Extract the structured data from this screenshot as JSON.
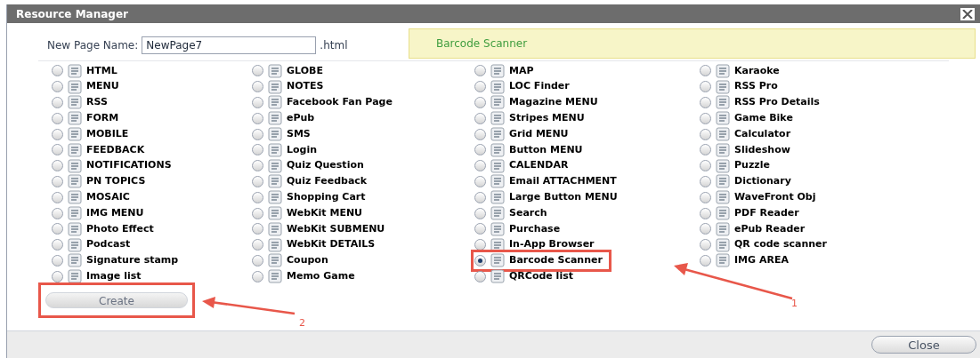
{
  "window": {
    "title": "Resource Manager"
  },
  "page_name": {
    "label": "New Page Name:",
    "value": "NewPage7",
    "suffix": ".html"
  },
  "banner": {
    "text": "Barcode Scanner"
  },
  "columns": [
    [
      {
        "label": "HTML",
        "selected": false,
        "highlighted": false
      },
      {
        "label": "MENU",
        "selected": false,
        "highlighted": false
      },
      {
        "label": "RSS",
        "selected": false,
        "highlighted": false
      },
      {
        "label": "FORM",
        "selected": false,
        "highlighted": false
      },
      {
        "label": "MOBILE",
        "selected": false,
        "highlighted": false
      },
      {
        "label": "FEEDBACK",
        "selected": false,
        "highlighted": false
      },
      {
        "label": "NOTIFICATIONS",
        "selected": false,
        "highlighted": false
      },
      {
        "label": "PN TOPICS",
        "selected": false,
        "highlighted": false
      },
      {
        "label": "MOSAIC",
        "selected": false,
        "highlighted": false
      },
      {
        "label": "IMG MENU",
        "selected": false,
        "highlighted": false
      },
      {
        "label": "Photo Effect",
        "selected": false,
        "highlighted": false
      },
      {
        "label": "Podcast",
        "selected": false,
        "highlighted": false
      },
      {
        "label": "Signature stamp",
        "selected": false,
        "highlighted": false
      },
      {
        "label": "Image list",
        "selected": false,
        "highlighted": false
      }
    ],
    [
      {
        "label": "GLOBE",
        "selected": false,
        "highlighted": false
      },
      {
        "label": "NOTES",
        "selected": false,
        "highlighted": false
      },
      {
        "label": "Facebook Fan Page",
        "selected": false,
        "highlighted": false
      },
      {
        "label": "ePub",
        "selected": false,
        "highlighted": false
      },
      {
        "label": "SMS",
        "selected": false,
        "highlighted": false
      },
      {
        "label": "Login",
        "selected": false,
        "highlighted": false
      },
      {
        "label": "Quiz Question",
        "selected": false,
        "highlighted": false
      },
      {
        "label": "Quiz Feedback",
        "selected": false,
        "highlighted": false
      },
      {
        "label": "Shopping Cart",
        "selected": false,
        "highlighted": false
      },
      {
        "label": "WebKit MENU",
        "selected": false,
        "highlighted": false
      },
      {
        "label": "WebKit SUBMENU",
        "selected": false,
        "highlighted": false
      },
      {
        "label": "WebKit DETAILS",
        "selected": false,
        "highlighted": false
      },
      {
        "label": "Coupon",
        "selected": false,
        "highlighted": false
      },
      {
        "label": "Memo Game",
        "selected": false,
        "highlighted": false
      }
    ],
    [
      {
        "label": "MAP",
        "selected": false,
        "highlighted": false
      },
      {
        "label": "LOC Finder",
        "selected": false,
        "highlighted": false
      },
      {
        "label": "Magazine MENU",
        "selected": false,
        "highlighted": false
      },
      {
        "label": "Stripes MENU",
        "selected": false,
        "highlighted": false
      },
      {
        "label": "Grid MENU",
        "selected": false,
        "highlighted": false
      },
      {
        "label": "Button MENU",
        "selected": false,
        "highlighted": false
      },
      {
        "label": "CALENDAR",
        "selected": false,
        "highlighted": false
      },
      {
        "label": "Email ATTACHMENT",
        "selected": false,
        "highlighted": false
      },
      {
        "label": "Large Button MENU",
        "selected": false,
        "highlighted": false
      },
      {
        "label": "Search",
        "selected": false,
        "highlighted": false
      },
      {
        "label": "Purchase",
        "selected": false,
        "highlighted": false
      },
      {
        "label": "In-App Browser",
        "selected": false,
        "highlighted": false
      },
      {
        "label": "Barcode Scanner",
        "selected": true,
        "highlighted": true
      },
      {
        "label": "QRCode list",
        "selected": false,
        "highlighted": false
      }
    ],
    [
      {
        "label": "Karaoke",
        "selected": false,
        "highlighted": false
      },
      {
        "label": "RSS Pro",
        "selected": false,
        "highlighted": false
      },
      {
        "label": "RSS Pro Details",
        "selected": false,
        "highlighted": false
      },
      {
        "label": "Game Bike",
        "selected": false,
        "highlighted": false
      },
      {
        "label": "Calculator",
        "selected": false,
        "highlighted": false
      },
      {
        "label": "Slideshow",
        "selected": false,
        "highlighted": false
      },
      {
        "label": "Puzzle",
        "selected": false,
        "highlighted": false
      },
      {
        "label": "Dictionary",
        "selected": false,
        "highlighted": false
      },
      {
        "label": "WaveFront Obj",
        "selected": false,
        "highlighted": false
      },
      {
        "label": "PDF Reader",
        "selected": false,
        "highlighted": false
      },
      {
        "label": "ePub Reader",
        "selected": false,
        "highlighted": false
      },
      {
        "label": "QR code scanner",
        "selected": false,
        "highlighted": false
      },
      {
        "label": "IMG AREA",
        "selected": false,
        "highlighted": false
      }
    ]
  ],
  "create_button": {
    "label": "Create",
    "highlighted": true
  },
  "close_button": {
    "label": "Close"
  },
  "annotations": [
    {
      "label": "1"
    },
    {
      "label": "2"
    }
  ]
}
